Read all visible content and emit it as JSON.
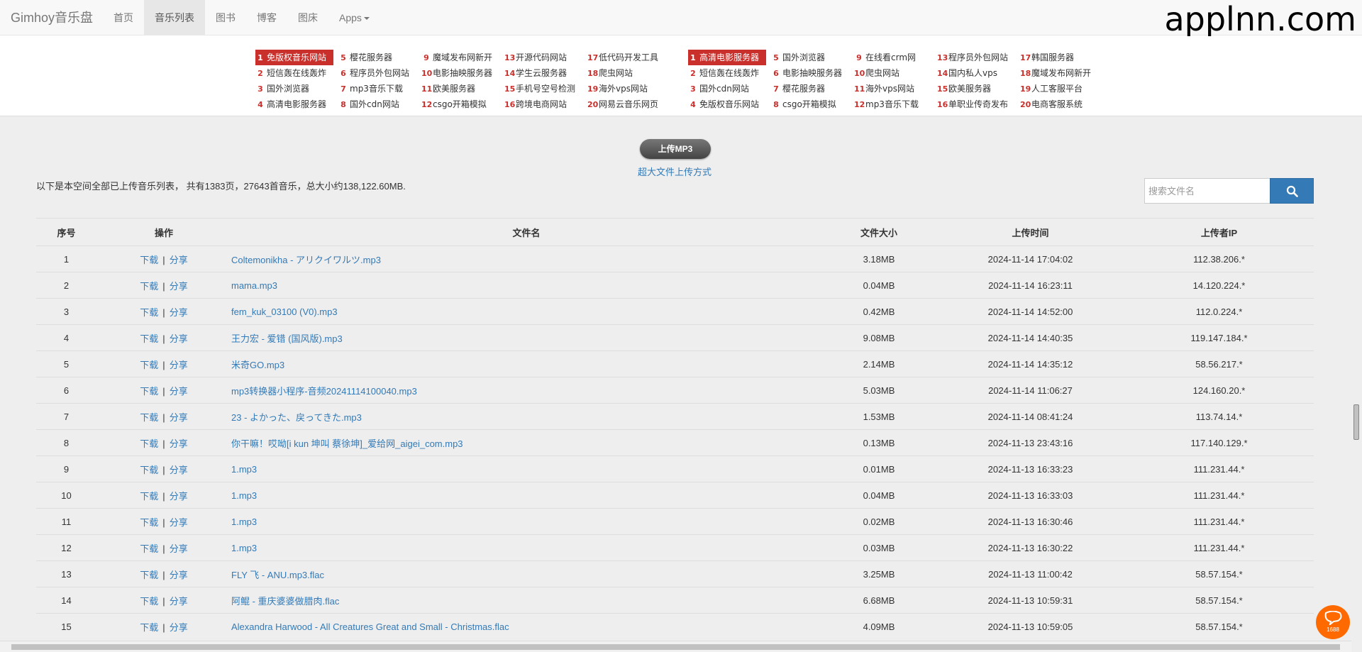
{
  "navbar": {
    "brand": "Gimhoy音乐盘",
    "items": [
      {
        "label": "首页"
      },
      {
        "label": "音乐列表"
      },
      {
        "label": "图书"
      },
      {
        "label": "博客"
      },
      {
        "label": "图床"
      },
      {
        "label": "Apps"
      }
    ],
    "active_index": 1
  },
  "watermark": "applnn.com",
  "ads_left": [
    [
      {
        "num": "1",
        "text": "免版权音乐网站"
      },
      {
        "num": "2",
        "text": "短信轰在线轰炸"
      },
      {
        "num": "3",
        "text": "国外浏览器"
      },
      {
        "num": "4",
        "text": "高清电影服务器"
      }
    ],
    [
      {
        "num": "5",
        "text": "樱花服务器"
      },
      {
        "num": "6",
        "text": "程序员外包网站"
      },
      {
        "num": "7",
        "text": "mp3音乐下载"
      },
      {
        "num": "8",
        "text": "国外cdn网站"
      }
    ],
    [
      {
        "num": "9",
        "text": "魔域发布网新开"
      },
      {
        "num": "10",
        "text": "电影抽映服务器"
      },
      {
        "num": "11",
        "text": "欧美服务器"
      },
      {
        "num": "12",
        "text": "csgo开箱模拟"
      }
    ],
    [
      {
        "num": "13",
        "text": "开源代码网站"
      },
      {
        "num": "14",
        "text": "学生云服务器"
      },
      {
        "num": "15",
        "text": "手机号空号检测"
      },
      {
        "num": "16",
        "text": "跨境电商网站"
      }
    ],
    [
      {
        "num": "17",
        "text": "低代码开发工具"
      },
      {
        "num": "18",
        "text": "爬虫网站"
      },
      {
        "num": "19",
        "text": "海外vps网站"
      },
      {
        "num": "20",
        "text": "网易云音乐网页"
      }
    ]
  ],
  "ads_right": [
    [
      {
        "num": "1",
        "text": "高清电影服务器"
      },
      {
        "num": "2",
        "text": "短信轰在线轰炸"
      },
      {
        "num": "3",
        "text": "国外cdn网站"
      },
      {
        "num": "4",
        "text": "免版权音乐网站"
      }
    ],
    [
      {
        "num": "5",
        "text": "国外浏览器"
      },
      {
        "num": "6",
        "text": "电影抽映服务器"
      },
      {
        "num": "7",
        "text": "樱花服务器"
      },
      {
        "num": "8",
        "text": "csgo开箱模拟"
      }
    ],
    [
      {
        "num": "9",
        "text": "在线看crm网"
      },
      {
        "num": "10",
        "text": "爬虫网站"
      },
      {
        "num": "11",
        "text": "海外vps网站"
      },
      {
        "num": "12",
        "text": "mp3音乐下载"
      }
    ],
    [
      {
        "num": "13",
        "text": "程序员外包网站"
      },
      {
        "num": "14",
        "text": "国内私人vps"
      },
      {
        "num": "15",
        "text": "欧美服务器"
      },
      {
        "num": "16",
        "text": "单职业传奇发布"
      }
    ],
    [
      {
        "num": "17",
        "text": "韩国服务器"
      },
      {
        "num": "18",
        "text": "魔域发布网新开"
      },
      {
        "num": "19",
        "text": "人工客服平台"
      },
      {
        "num": "20",
        "text": "电商客服系统"
      }
    ]
  ],
  "upload_button": "上传MP3",
  "big_file_link": "超大文件上传方式",
  "summary": "以下是本空间全部已上传音乐列表， 共有1383页，27643首音乐，总大小约138,122.60MB.",
  "search": {
    "placeholder": "搜索文件名",
    "value": ""
  },
  "table": {
    "headers": [
      "序号",
      "操作",
      "文件名",
      "文件大小",
      "上传时间",
      "上传者IP"
    ],
    "action_download": "下载",
    "action_separator": "|",
    "action_share": "分享",
    "rows": [
      {
        "no": "1",
        "name": "Coltemonikha - アリクイワルツ.mp3",
        "size": "3.18MB",
        "time": "2024-11-14 17:04:02",
        "ip": "112.38.206.*"
      },
      {
        "no": "2",
        "name": "mama.mp3",
        "size": "0.04MB",
        "time": "2024-11-14 16:23:11",
        "ip": "14.120.224.*"
      },
      {
        "no": "3",
        "name": "fem_kuk_03100 (V0).mp3",
        "size": "0.42MB",
        "time": "2024-11-14 14:52:00",
        "ip": "112.0.224.*"
      },
      {
        "no": "4",
        "name": "王力宏 - 爱错 (国风版).mp3",
        "size": "9.08MB",
        "time": "2024-11-14 14:40:35",
        "ip": "119.147.184.*"
      },
      {
        "no": "5",
        "name": "米奇GO.mp3",
        "size": "2.14MB",
        "time": "2024-11-14 14:35:12",
        "ip": "58.56.217.*"
      },
      {
        "no": "6",
        "name": "mp3转换器小程序-音频20241114100040.mp3",
        "size": "5.03MB",
        "time": "2024-11-14 11:06:27",
        "ip": "124.160.20.*"
      },
      {
        "no": "7",
        "name": "23 - よかった、戻ってきた.mp3",
        "size": "1.53MB",
        "time": "2024-11-14 08:41:24",
        "ip": "113.74.14.*"
      },
      {
        "no": "8",
        "name": "你干嘛！哎呦[i kun 坤叫 蔡徐坤]_爱给网_aigei_com.mp3",
        "size": "0.13MB",
        "time": "2024-11-13 23:43:16",
        "ip": "117.140.129.*"
      },
      {
        "no": "9",
        "name": "1.mp3",
        "size": "0.01MB",
        "time": "2024-11-13 16:33:23",
        "ip": "111.231.44.*"
      },
      {
        "no": "10",
        "name": "1.mp3",
        "size": "0.04MB",
        "time": "2024-11-13 16:33:03",
        "ip": "111.231.44.*"
      },
      {
        "no": "11",
        "name": "1.mp3",
        "size": "0.02MB",
        "time": "2024-11-13 16:30:46",
        "ip": "111.231.44.*"
      },
      {
        "no": "12",
        "name": "1.mp3",
        "size": "0.03MB",
        "time": "2024-11-13 16:30:22",
        "ip": "111.231.44.*"
      },
      {
        "no": "13",
        "name": "FLY 飞 - ANU.mp3.flac",
        "size": "3.25MB",
        "time": "2024-11-13 11:00:42",
        "ip": "58.57.154.*"
      },
      {
        "no": "14",
        "name": "阿鲲 - 重庆婆婆做腊肉.flac",
        "size": "6.68MB",
        "time": "2024-11-13 10:59:31",
        "ip": "58.57.154.*"
      },
      {
        "no": "15",
        "name": "Alexandra Harwood - All Creatures Great and Small - Christmas.flac",
        "size": "4.09MB",
        "time": "2024-11-13 10:59:05",
        "ip": "58.57.154.*"
      }
    ]
  },
  "float_badge": {
    "label": "1688",
    "icon": "chat-bubble-icon"
  },
  "colors": {
    "link": "#337ab7",
    "ad_highlight": "#c9302c",
    "search_button": "#337ab7",
    "badge": "#ff6a00"
  }
}
